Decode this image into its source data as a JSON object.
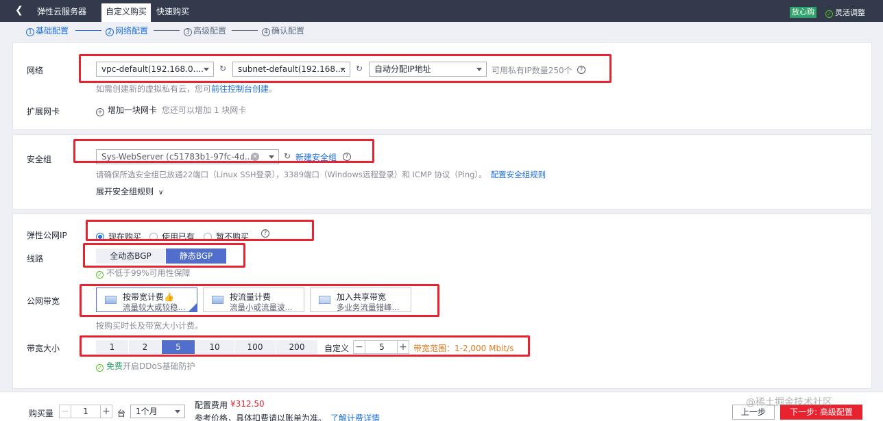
{
  "topbar": {
    "back_icon": "chevron-left",
    "title": "弹性云服务器",
    "tabs": [
      {
        "label": "自定义购买",
        "active": true
      },
      {
        "label": "快速购买",
        "active": false
      }
    ],
    "badge": "放心购",
    "flex_adjust": "灵活调整"
  },
  "steps": [
    {
      "num": "1",
      "label": "基础配置"
    },
    {
      "num": "2",
      "label": "网络配置"
    },
    {
      "num": "3",
      "label": "高级配置"
    },
    {
      "num": "4",
      "label": "确认配置"
    }
  ],
  "network": {
    "label": "网络",
    "vpc_value": "vpc-default(192.168.0....",
    "subnet_value": "subnet-default(192.168....",
    "ip_value": "自动分配IP地址",
    "available_ips": "可用私有IP数量250个",
    "hint_prefix": "如需创建新的虚拟私有云，您可",
    "hint_link": "前往控制台创建",
    "hint_suffix": "。"
  },
  "nic": {
    "label": "扩展网卡",
    "add_label": "增加一块网卡",
    "hint": "您还可以增加 1 块网卡"
  },
  "security_group": {
    "label": "安全组",
    "value": "Sys-WebServer (c51783b1-97fc-4d...",
    "new_link": "新建安全组",
    "hint": "请确保所选安全组已放通22端口（Linux SSH登录），3389端口（Windows远程登录）和 ICMP 协议（Ping）。",
    "config_link": "配置安全组规则",
    "expand_label": "展开安全组规则"
  },
  "eip": {
    "label": "弹性公网IP",
    "options": [
      "现在购买",
      "使用已有",
      "暂不购买"
    ],
    "selected": 0
  },
  "line": {
    "label": "线路",
    "options": [
      "全动态BGP",
      "静态BGP"
    ],
    "selected": 1,
    "availability": "不低于99%可用性保障"
  },
  "bandwidth_type": {
    "label": "公网带宽",
    "cards": [
      {
        "title": "按带宽计费",
        "desc": "流量较大或较稳...",
        "icon": "bandwidth-icon",
        "selected": true
      },
      {
        "title": "按流量计费",
        "desc": "流量小或流量波...",
        "icon": "traffic-icon",
        "selected": false
      },
      {
        "title": "加入共享带宽",
        "desc": "多业务流量错峰...",
        "icon": "shared-bandwidth-icon",
        "selected": false
      }
    ],
    "hint": "按购买时长及带宽大小计费。"
  },
  "bandwidth_size": {
    "label": "带宽大小",
    "options": [
      "1",
      "2",
      "5",
      "10",
      "100",
      "200"
    ],
    "selected": 2,
    "custom_label": "自定义",
    "value": "5",
    "range": "带宽范围：1-2,000 Mbit/s",
    "ddos_free": "免费",
    "ddos_text": "开启DDoS基础防护"
  },
  "footer": {
    "quantity_label": "购买量",
    "quantity": "1",
    "unit": "台",
    "duration": "1个月",
    "fee_label": "配置费用",
    "fee_value": "¥312.50",
    "fee_note": "参考价格，具体扣费请以账单为准。",
    "fee_link": "了解计费详情",
    "prev_label": "上一步",
    "next_label": "下一步: 高级配置",
    "watermark": "@稀土掘金技术社区"
  },
  "colors": {
    "accent": "#1e6fe0",
    "selected_bg": "#526ecc",
    "annotation_red": "#e8222e",
    "price": "#e8222e",
    "range": "#e07a1e"
  }
}
